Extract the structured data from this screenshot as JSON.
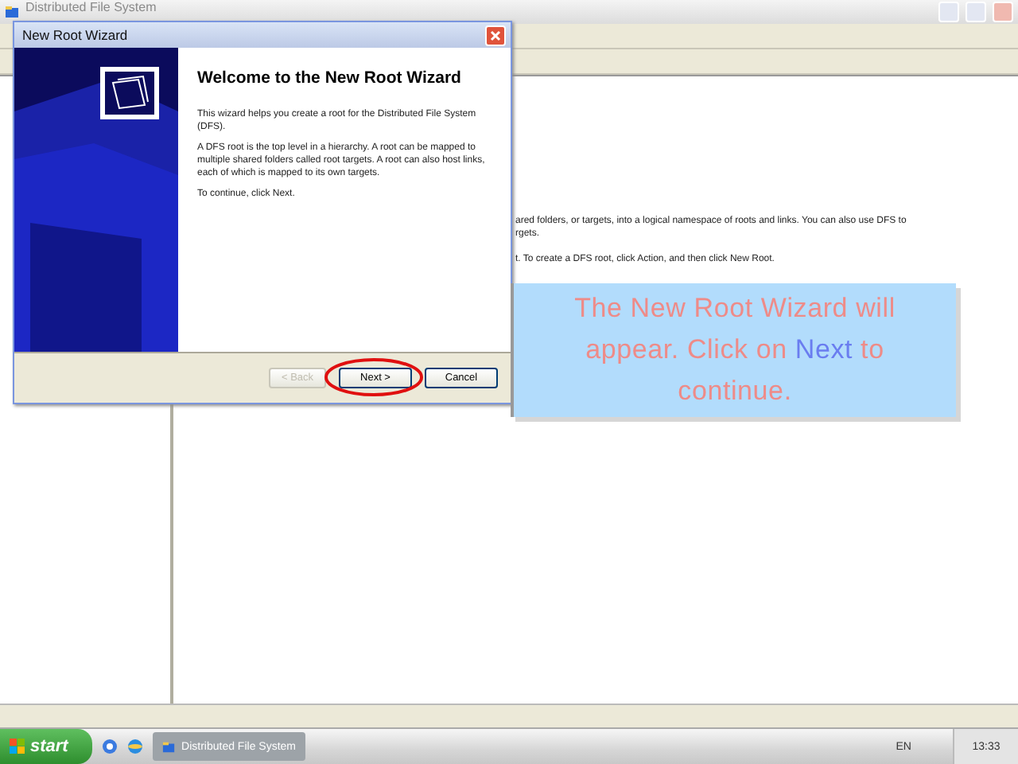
{
  "main_window": {
    "title": "Distributed File System",
    "active": false,
    "content_lines": [
      "ared folders, or targets, into a logical namespace of roots and links. You can also use DFS to",
      "rgets.",
      "t. To create a DFS root, click Action, and then click New Root."
    ]
  },
  "wizard": {
    "title": "New Root Wizard",
    "heading": "Welcome to the New Root Wizard",
    "paragraphs": [
      "This wizard helps you create a root for the Distributed File System (DFS).",
      "A DFS root is the top level in a hierarchy. A root can be mapped to multiple shared folders called root targets. A root can also host links, each of which is mapped to its own targets.",
      "To continue, click Next."
    ],
    "buttons": [
      {
        "label": "< Back",
        "disabled": true,
        "highlighted": false
      },
      {
        "label": "Next >",
        "disabled": false,
        "highlighted": true
      },
      {
        "label": "Cancel",
        "disabled": false,
        "highlighted": false
      }
    ]
  },
  "callout": {
    "parts": [
      {
        "text": "The New Root Wizard will appear. Click on ",
        "kind": "plain"
      },
      {
        "text": "Next",
        "kind": "highlight"
      },
      {
        "text": " to continue.",
        "kind": "plain"
      }
    ]
  },
  "taskbar": {
    "start": "start",
    "tasks": [
      {
        "label": "Distributed File System",
        "selected": true
      }
    ],
    "language": "EN",
    "clock": "13:33"
  }
}
